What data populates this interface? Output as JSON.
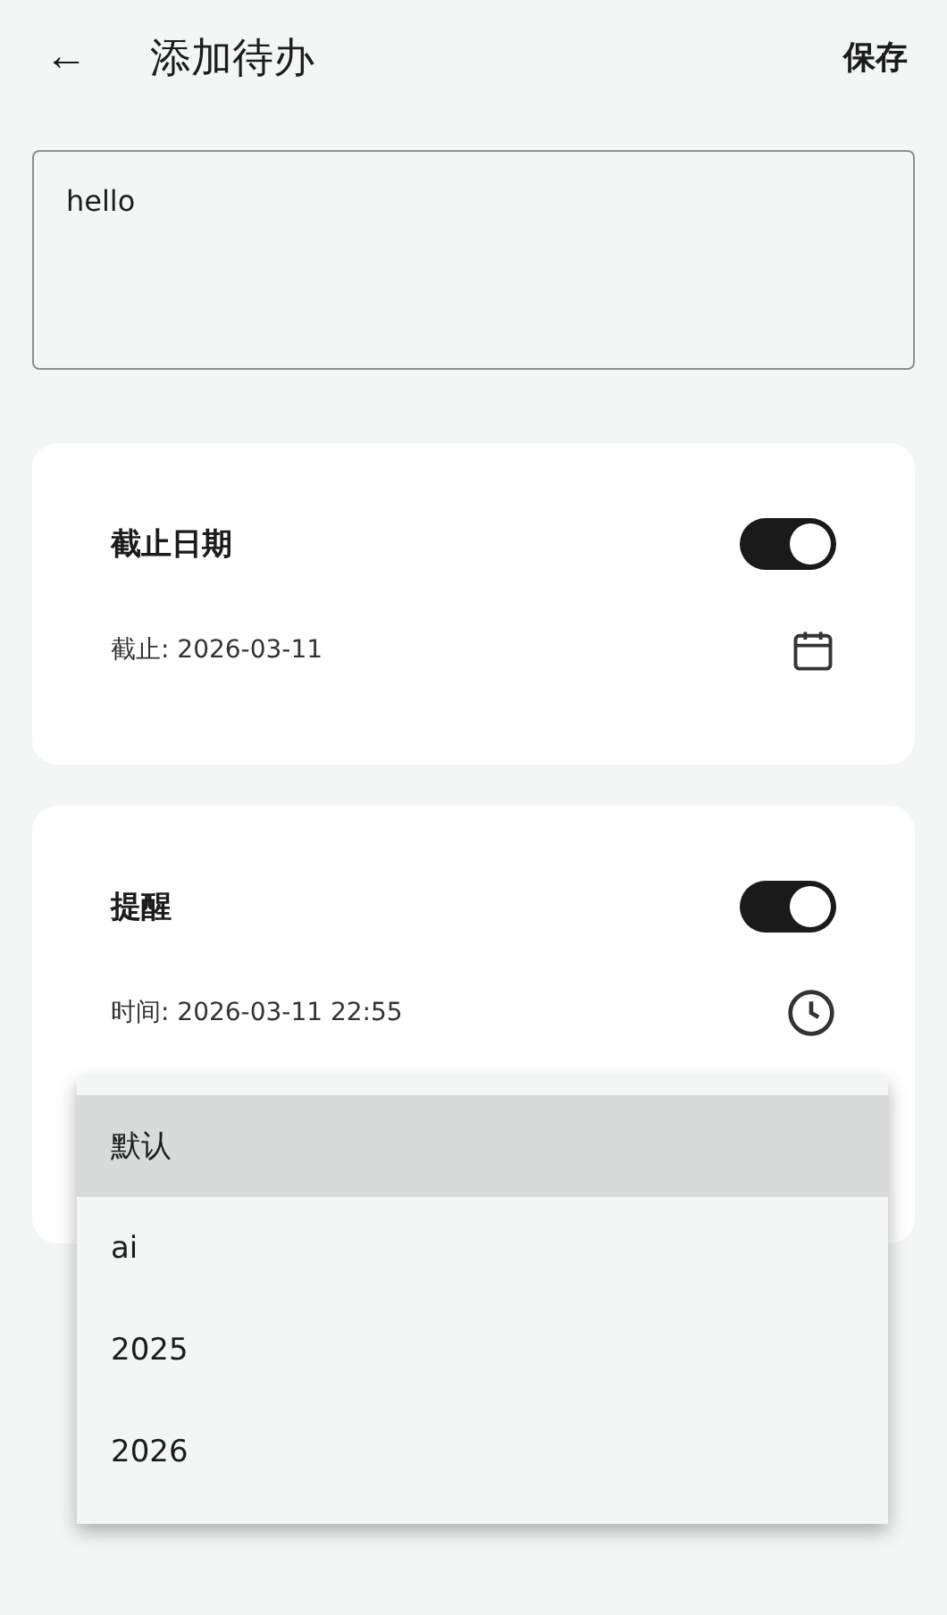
{
  "header": {
    "back": "←",
    "title": "添加待办",
    "save": "保存"
  },
  "text_field": {
    "value": "hello"
  },
  "cards": [
    {
      "kind": "date",
      "title": "截止日期",
      "on": true,
      "detail": "截止: 2026-03-11"
    },
    {
      "kind": "time",
      "title": "提醒",
      "on": true,
      "detail": "时间: 2026-03-11 22:55"
    }
  ],
  "menu": {
    "items": [
      {
        "label": "默认",
        "selected": true
      },
      {
        "label": "ai",
        "selected": false
      },
      {
        "label": "2025",
        "selected": false
      },
      {
        "label": "2026",
        "selected": false
      }
    ]
  }
}
